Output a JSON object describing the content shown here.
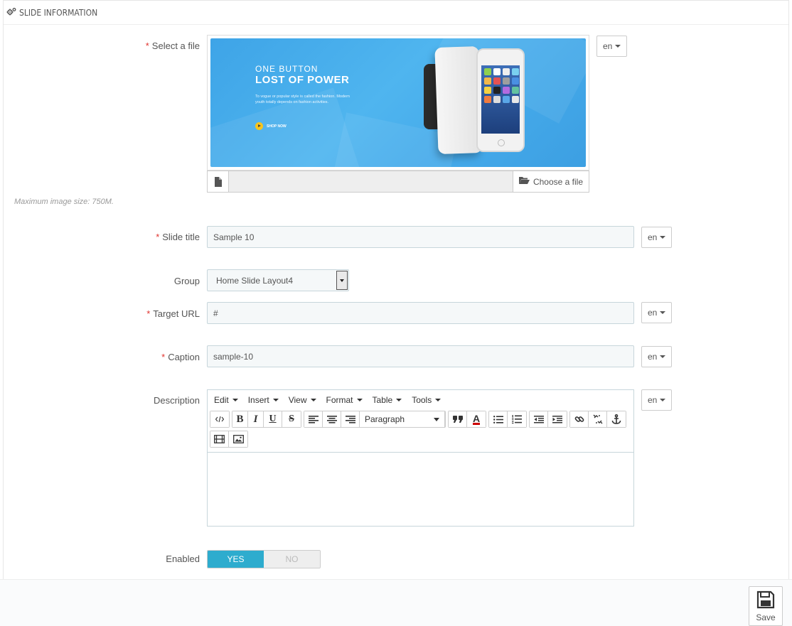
{
  "panel": {
    "title": "SLIDE INFORMATION",
    "icon": "cogs-icon"
  },
  "file": {
    "label": "Select a file",
    "required": "*",
    "lang": "en",
    "choose_label": "Choose a file",
    "help": "Maximum image size: 750M.",
    "banner": {
      "line1": "ONE BUTTON",
      "line2": "LOST OF POWER",
      "line3": "To vogue or popular style is called the fashion. Modern youth totally depends on fashion activities.",
      "cta": "SHOP NOW"
    }
  },
  "slide_title": {
    "label": "Slide title",
    "required": "*",
    "value": "Sample 10",
    "lang": "en"
  },
  "group": {
    "label": "Group",
    "value": "Home Slide Layout4"
  },
  "target_url": {
    "label": "Target URL",
    "required": "*",
    "value": "#",
    "lang": "en"
  },
  "caption": {
    "label": "Caption",
    "required": "*",
    "value": "sample-10",
    "lang": "en"
  },
  "description": {
    "label": "Description",
    "lang": "en",
    "menus": {
      "edit": "Edit",
      "insert": "Insert",
      "view": "View",
      "format": "Format",
      "table": "Table",
      "tools": "Tools"
    },
    "block_format": "Paragraph",
    "bold": "B",
    "italic": "I",
    "underline": "U",
    "strike": "S",
    "text_color": "A"
  },
  "enabled": {
    "label": "Enabled",
    "yes": "YES",
    "no": "NO",
    "value": "YES"
  },
  "footer": {
    "save_label": "Save"
  },
  "colors": {
    "accent": "#2eacce",
    "required": "#e0342f",
    "banner": "#4fb5ef"
  }
}
